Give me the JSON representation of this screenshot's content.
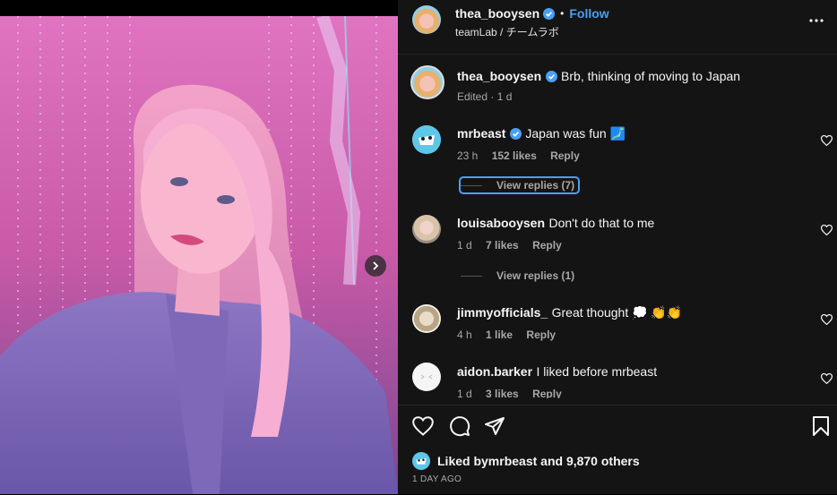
{
  "post": {
    "author": "thea_booysen",
    "separator": "•",
    "follow_label": "Follow",
    "location": "teamLab / チームラボ",
    "more_icon": "more-icon"
  },
  "caption": {
    "author": "thea_booysen",
    "text": "Brb, thinking of moving to Japan",
    "edited": "Edited · 1 d"
  },
  "comments": [
    {
      "user": "mrbeast",
      "verified": true,
      "text": "Japan was fun 🗾",
      "time": "23 h",
      "likes": "152 likes",
      "reply": "Reply",
      "view_replies": "View replies (7)"
    },
    {
      "user": "louisabooysen",
      "verified": false,
      "text": "Don't do that to me",
      "time": "1 d",
      "likes": "7 likes",
      "reply": "Reply",
      "view_replies": "View replies (1)"
    },
    {
      "user": "jimmyofficials_",
      "verified": false,
      "text": "Great thought 💭 👏👏",
      "time": "4 h",
      "likes": "1 like",
      "reply": "Reply"
    },
    {
      "user": "aidon.barker",
      "verified": false,
      "text": "I liked before mrbeast",
      "time": "1 d",
      "likes": "3 likes",
      "reply": "Reply"
    }
  ],
  "likes_line": {
    "prefix": "Liked by ",
    "user": "mrbeast",
    "middle": " and ",
    "count": "9,870 others"
  },
  "timestamp": "1 DAY AGO",
  "colors": {
    "accent": "#4a9ff5",
    "panel": "#141414",
    "muted": "#a8a8a8"
  }
}
